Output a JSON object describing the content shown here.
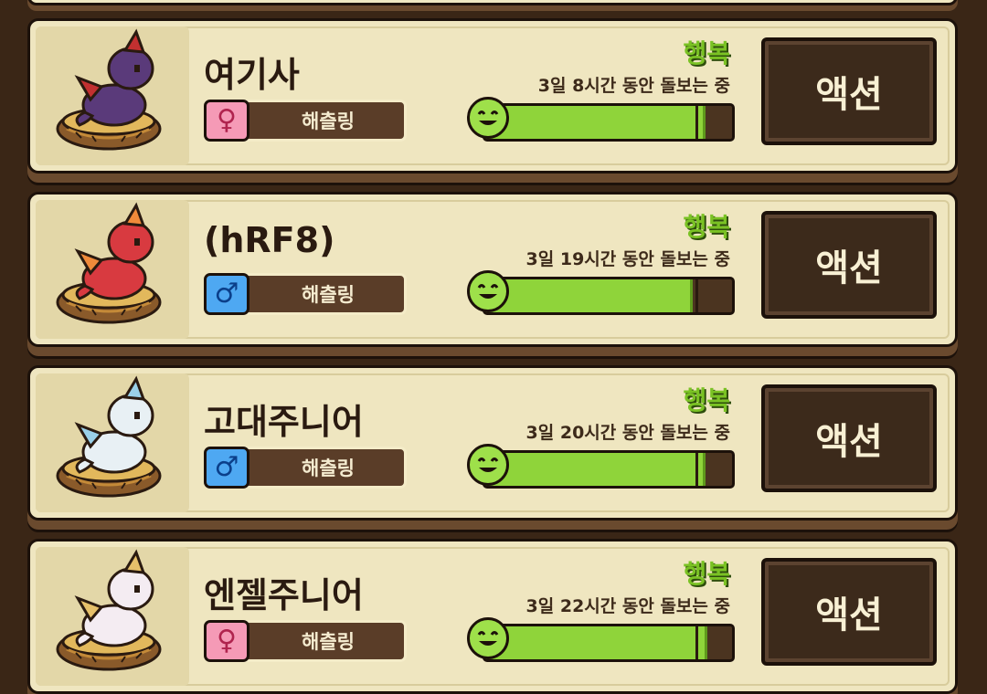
{
  "pets": [
    {
      "name": "여기사",
      "gender": "female",
      "gender_symbol": "♀",
      "stage": "해츨링",
      "mood": "행복",
      "care_time": "3일 8시간 동안 돌보는 중",
      "happiness_fraction": 0.88,
      "action_label": "액션",
      "dragon_color": "#5a3a7a",
      "dragon_accent": "#c23030"
    },
    {
      "name": "(hRF8)",
      "gender": "male",
      "gender_symbol": "♂",
      "stage": "해츨링",
      "mood": "행복",
      "care_time": "3일 19시간 동안 돌보는 중",
      "happiness_fraction": 0.83,
      "action_label": "액션",
      "dragon_color": "#d83a40",
      "dragon_accent": "#f08a3a"
    },
    {
      "name": "고대주니어",
      "gender": "male",
      "gender_symbol": "♂",
      "stage": "해츨링",
      "mood": "행복",
      "care_time": "3일 20시간 동안 돌보는 중",
      "happiness_fraction": 0.88,
      "action_label": "액션",
      "dragon_color": "#e8f0f4",
      "dragon_accent": "#9ad0e8"
    },
    {
      "name": "엔젤주니어",
      "gender": "female",
      "gender_symbol": "♀",
      "stage": "해츨링",
      "mood": "행복",
      "care_time": "3일 22시간 동안 돌보는 중",
      "happiness_fraction": 0.89,
      "action_label": "액션",
      "dragon_color": "#f4ecf2",
      "dragon_accent": "#e6c06a"
    }
  ]
}
